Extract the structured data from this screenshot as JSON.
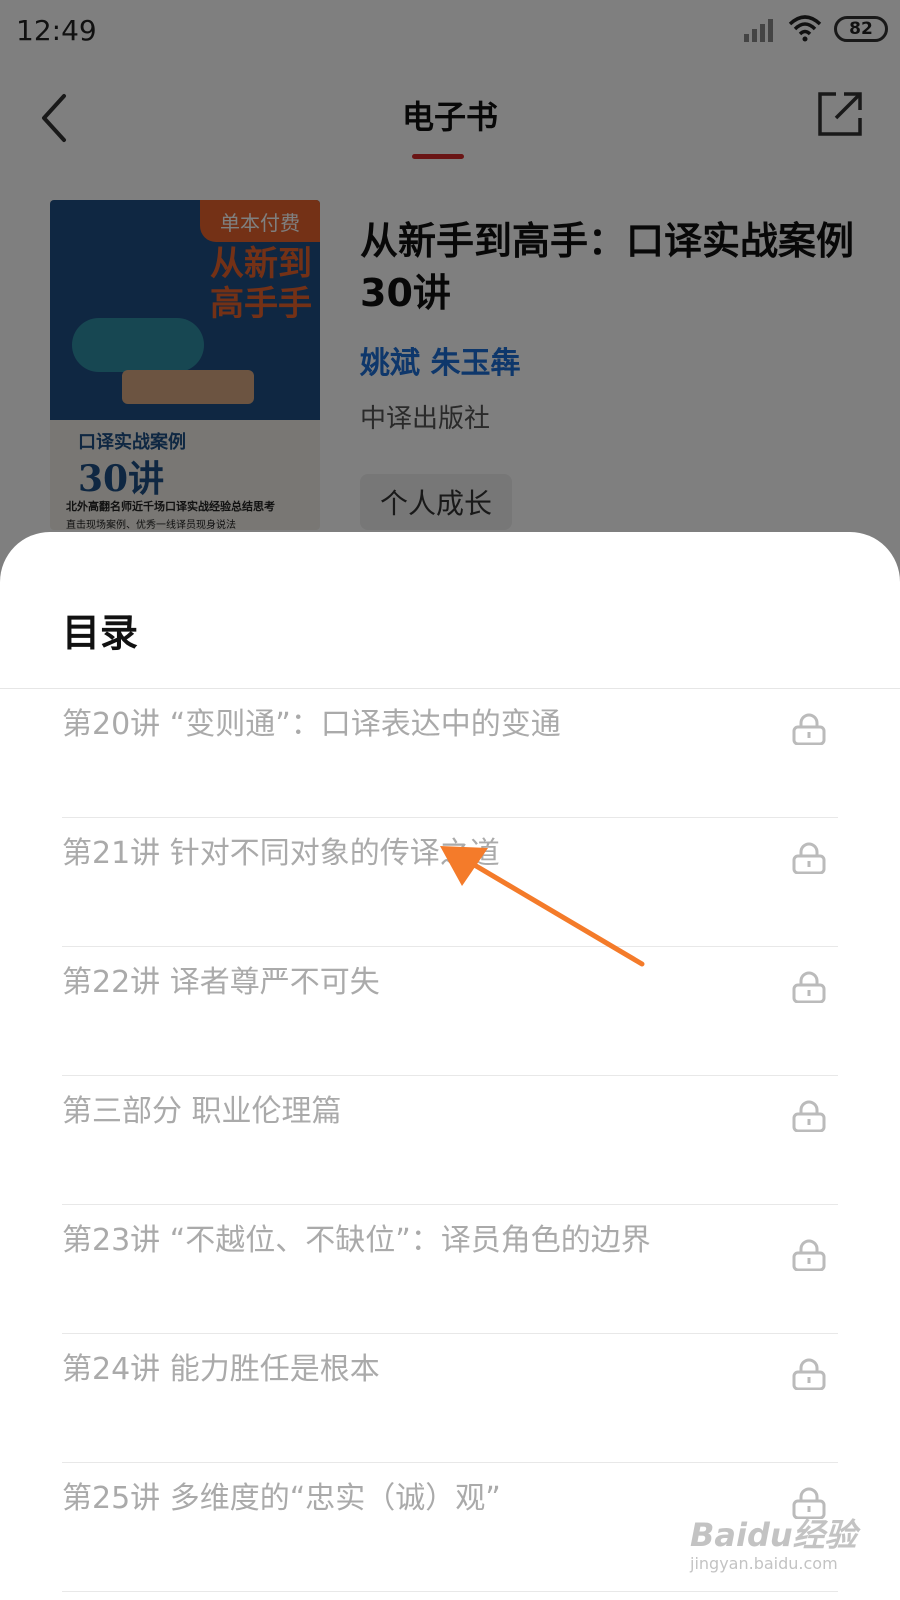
{
  "status_bar": {
    "time": "12:49",
    "battery": "82"
  },
  "nav": {
    "title": "电子书"
  },
  "book": {
    "cover_badge": "单本付费",
    "cover_big_title": "从新到高手手",
    "cover_subtitle": "口译实战案例",
    "cover_number": "30讲",
    "cover_line1": "北外高翻名师近千场口译实战经验总结思考",
    "cover_line2": "直击现场案例、优秀一线译员现身说法",
    "title": "从新手到高手：口译实战案例30讲",
    "authors": "姚斌 朱玉犇",
    "publisher": "中译出版社",
    "tag": "个人成长"
  },
  "toc": {
    "title": "目录",
    "items": [
      {
        "label": "第20讲 “变则通”：口译表达中的变通",
        "locked": true
      },
      {
        "label": "第21讲 针对不同对象的传译之道",
        "locked": true
      },
      {
        "label": "第22讲 译者尊严不可失",
        "locked": true
      },
      {
        "label": "第三部分 职业伦理篇",
        "locked": true
      },
      {
        "label": "第23讲 “不越位、不缺位”：译员角色的边界",
        "locked": true
      },
      {
        "label": "第24讲 能力胜任是根本",
        "locked": true
      },
      {
        "label": "第25讲 多维度的“忠实（诚）观”",
        "locked": true
      }
    ]
  },
  "watermark": {
    "brand": "Baidu经验",
    "url": "jingyan.baidu.com"
  },
  "colors": {
    "accent": "#d42a2a",
    "author_link": "#1c6ed6",
    "annotation_arrow": "#f47b2a"
  }
}
